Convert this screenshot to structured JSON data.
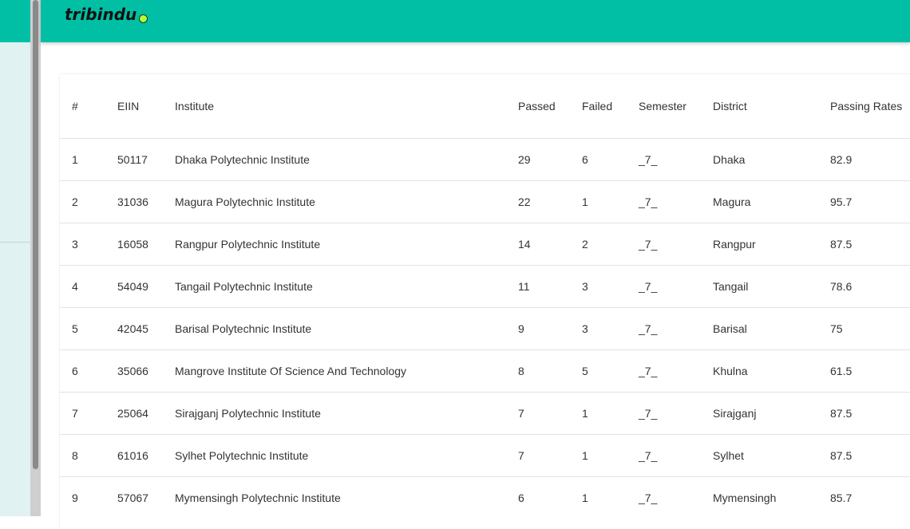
{
  "app": {
    "logo_text": "tribindu"
  },
  "colors": {
    "accent": "#00bfa5",
    "sidebar_bg": "#e0f2f1",
    "logo_dot": "#b5ff3b"
  },
  "table": {
    "headers": [
      "#",
      "EIIN",
      "Institute",
      "Passed",
      "Failed",
      "Semester",
      "District",
      "Passing Rates"
    ],
    "rows": [
      [
        "1",
        "50117",
        "Dhaka Polytechnic Institute",
        "29",
        "6",
        "_7_",
        "Dhaka",
        "82.9"
      ],
      [
        "2",
        "31036",
        "Magura Polytechnic Institute",
        "22",
        "1",
        "_7_",
        "Magura",
        "95.7"
      ],
      [
        "3",
        "16058",
        "Rangpur Polytechnic Institute",
        "14",
        "2",
        "_7_",
        "Rangpur",
        "87.5"
      ],
      [
        "4",
        "54049",
        "Tangail Polytechnic Institute",
        "11",
        "3",
        "_7_",
        "Tangail",
        "78.6"
      ],
      [
        "5",
        "42045",
        "Barisal Polytechnic Institute",
        "9",
        "3",
        "_7_",
        "Barisal",
        "75"
      ],
      [
        "6",
        "35066",
        "Mangrove Institute Of Science And Technology",
        "8",
        "5",
        "_7_",
        "Khulna",
        "61.5"
      ],
      [
        "7",
        "25064",
        "Sirajganj Polytechnic Institute",
        "7",
        "1",
        "_7_",
        "Sirajganj",
        "87.5"
      ],
      [
        "8",
        "61016",
        "Sylhet Polytechnic Institute",
        "7",
        "1",
        "_7_",
        "Sylhet",
        "87.5"
      ],
      [
        "9",
        "57067",
        "Mymensingh Polytechnic Institute",
        "6",
        "1",
        "_7_",
        "Mymensingh",
        "85.7"
      ]
    ]
  }
}
